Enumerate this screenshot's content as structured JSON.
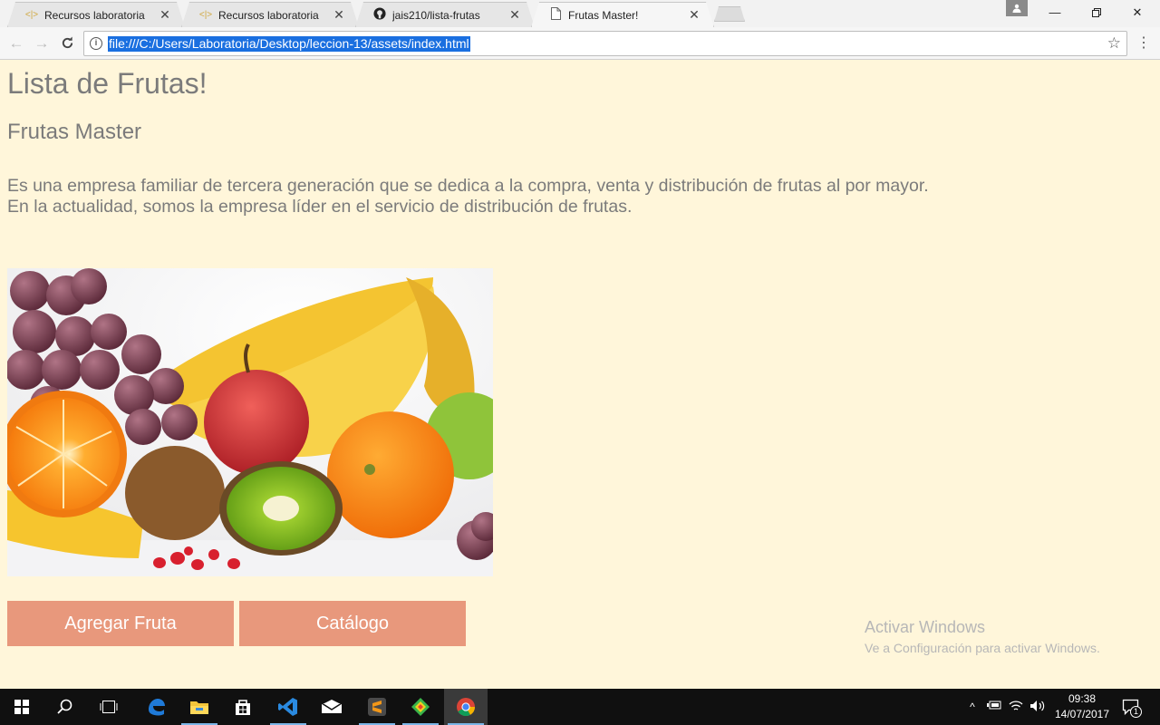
{
  "browser": {
    "tabs": [
      {
        "title": "Recursos laboratoria",
        "favicon": "code-bracket-icon"
      },
      {
        "title": "Recursos laboratoria",
        "favicon": "code-bracket-icon"
      },
      {
        "title": "jais210/lista-frutas",
        "favicon": "github-icon"
      },
      {
        "title": "Frutas Master!",
        "favicon": "document-icon"
      }
    ],
    "url": "file:///C:/Users/Laboratoria/Desktop/leccion-13/assets/index.html"
  },
  "page": {
    "title": "Lista de Frutas!",
    "company": "Frutas Master",
    "description_line1": "Es una empresa familiar de tercera generación que se dedica a la compra, venta y distribución de frutas al por mayor.",
    "description_line2": "En la actualidad, somos la empresa líder en el servicio de distribución de frutas.",
    "buttons": {
      "add": "Agregar Fruta",
      "catalog": "Catálogo"
    },
    "button_color": "#e8987c"
  },
  "watermark": {
    "title": "Activar Windows",
    "subtitle": "Ve a Configuración para activar Windows."
  },
  "taskbar": {
    "time": "09:38",
    "date": "14/07/2017",
    "notifications": "1"
  }
}
